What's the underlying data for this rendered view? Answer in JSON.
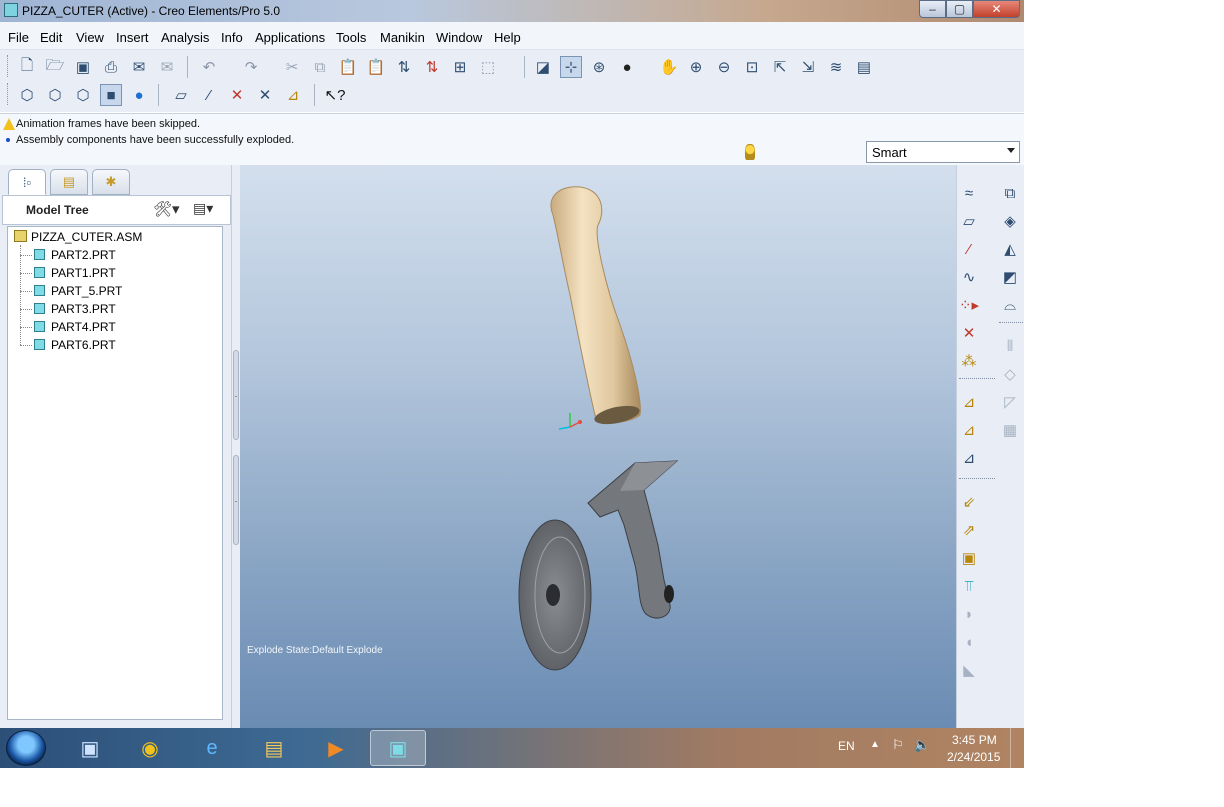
{
  "window": {
    "title": "PIZZA_CUTER (Active) - Creo Elements/Pro 5.0",
    "minimize": "‒",
    "maximize": "▢",
    "close": "✕"
  },
  "menu": [
    "File",
    "Edit",
    "View",
    "Insert",
    "Analysis",
    "Info",
    "Applications",
    "Tools",
    "Manikin",
    "Window",
    "Help"
  ],
  "messages": [
    "Animation frames have been skipped.",
    "Assembly components have been successfully exploded."
  ],
  "filter": {
    "selected": "Smart"
  },
  "model_tree": {
    "title": "Model Tree",
    "root": "PIZZA_CUTER.ASM",
    "parts": [
      "PART2.PRT",
      "PART1.PRT",
      "PART_5.PRT",
      "PART3.PRT",
      "PART4.PRT",
      "PART6.PRT"
    ]
  },
  "viewport": {
    "explode_state": "Explode State:Default Explode"
  },
  "taskbar": {
    "language": "EN",
    "time": "3:45 PM",
    "date": "2/24/2015"
  },
  "colors": {
    "handle": "#e4cda6",
    "metal": "#6f7277",
    "viewport_top": "#d3dfed",
    "viewport_bottom": "#6a8bb3"
  }
}
